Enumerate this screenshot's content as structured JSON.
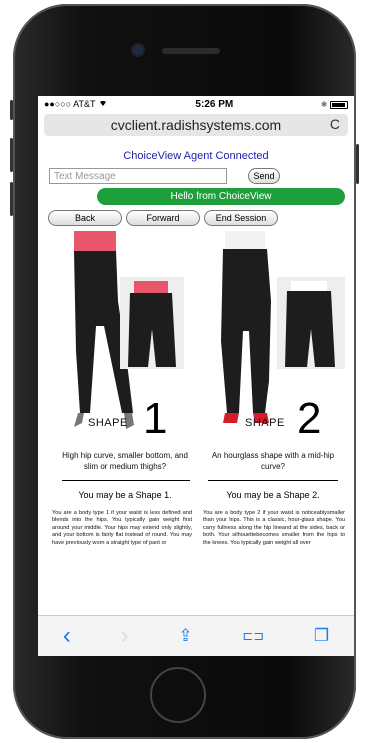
{
  "status_bar": {
    "carrier": "●●○○○ AT&T",
    "wifi_icon": "wifi",
    "time": "5:26 PM",
    "bluetooth": "✱"
  },
  "browser": {
    "url": "cvclient.radishsystems.com",
    "reload_icon": "C"
  },
  "agent_status": "ChoiceView Agent Connected",
  "message": {
    "placeholder": "Text Message",
    "send_label": "Send"
  },
  "banner": "Hello from ChoiceView",
  "nav": {
    "back": "Back",
    "forward": "Forward",
    "end": "End Session"
  },
  "shapes": [
    {
      "label": "SHAPE",
      "number": "1",
      "question": "High hip curve, smaller bottom, and slim or medium thighs?",
      "answer": "You may be a Shape 1.",
      "body": "You are a body type 1 if your waist is less defined and blends into the hips. You typically gain weight first around your middle. Your hips may extend only slightly, and your bottom is fairly flat instead of round. You may have previously worn a straight type of pant or"
    },
    {
      "label": "SHAPE",
      "number": "2",
      "question": "An hourglass shape with a mid-hip curve?",
      "answer": "You may be a Shape 2.",
      "body": "You are a body type 2 if your waist is noticeablysmaller than your hips. This is a classic, hour-glass shape. You carry fullness along the hip lineand at the sides, back or both. Your silhouettebecomes smaller from the hips to the knees. You typically gain weight all over"
    }
  ],
  "toolbar": {
    "back": "‹",
    "forward": "›",
    "share": "⇪",
    "bookmarks": "⊏⊐",
    "tabs": "❐"
  }
}
